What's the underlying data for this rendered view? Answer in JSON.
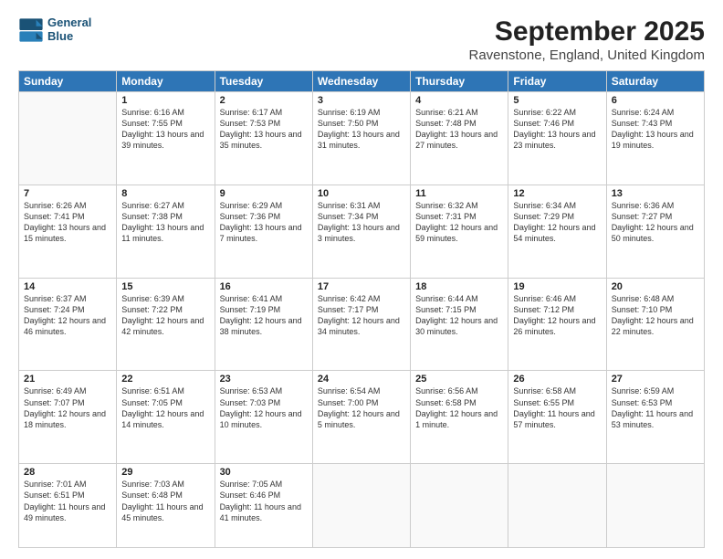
{
  "title": "September 2025",
  "subtitle": "Ravenstone, England, United Kingdom",
  "logo": {
    "line1": "General",
    "line2": "Blue"
  },
  "days": [
    "Sunday",
    "Monday",
    "Tuesday",
    "Wednesday",
    "Thursday",
    "Friday",
    "Saturday"
  ],
  "weeks": [
    [
      {
        "date": "",
        "sunrise": "",
        "sunset": "",
        "daylight": ""
      },
      {
        "date": "1",
        "sunrise": "Sunrise: 6:16 AM",
        "sunset": "Sunset: 7:55 PM",
        "daylight": "Daylight: 13 hours and 39 minutes."
      },
      {
        "date": "2",
        "sunrise": "Sunrise: 6:17 AM",
        "sunset": "Sunset: 7:53 PM",
        "daylight": "Daylight: 13 hours and 35 minutes."
      },
      {
        "date": "3",
        "sunrise": "Sunrise: 6:19 AM",
        "sunset": "Sunset: 7:50 PM",
        "daylight": "Daylight: 13 hours and 31 minutes."
      },
      {
        "date": "4",
        "sunrise": "Sunrise: 6:21 AM",
        "sunset": "Sunset: 7:48 PM",
        "daylight": "Daylight: 13 hours and 27 minutes."
      },
      {
        "date": "5",
        "sunrise": "Sunrise: 6:22 AM",
        "sunset": "Sunset: 7:46 PM",
        "daylight": "Daylight: 13 hours and 23 minutes."
      },
      {
        "date": "6",
        "sunrise": "Sunrise: 6:24 AM",
        "sunset": "Sunset: 7:43 PM",
        "daylight": "Daylight: 13 hours and 19 minutes."
      }
    ],
    [
      {
        "date": "7",
        "sunrise": "Sunrise: 6:26 AM",
        "sunset": "Sunset: 7:41 PM",
        "daylight": "Daylight: 13 hours and 15 minutes."
      },
      {
        "date": "8",
        "sunrise": "Sunrise: 6:27 AM",
        "sunset": "Sunset: 7:38 PM",
        "daylight": "Daylight: 13 hours and 11 minutes."
      },
      {
        "date": "9",
        "sunrise": "Sunrise: 6:29 AM",
        "sunset": "Sunset: 7:36 PM",
        "daylight": "Daylight: 13 hours and 7 minutes."
      },
      {
        "date": "10",
        "sunrise": "Sunrise: 6:31 AM",
        "sunset": "Sunset: 7:34 PM",
        "daylight": "Daylight: 13 hours and 3 minutes."
      },
      {
        "date": "11",
        "sunrise": "Sunrise: 6:32 AM",
        "sunset": "Sunset: 7:31 PM",
        "daylight": "Daylight: 12 hours and 59 minutes."
      },
      {
        "date": "12",
        "sunrise": "Sunrise: 6:34 AM",
        "sunset": "Sunset: 7:29 PM",
        "daylight": "Daylight: 12 hours and 54 minutes."
      },
      {
        "date": "13",
        "sunrise": "Sunrise: 6:36 AM",
        "sunset": "Sunset: 7:27 PM",
        "daylight": "Daylight: 12 hours and 50 minutes."
      }
    ],
    [
      {
        "date": "14",
        "sunrise": "Sunrise: 6:37 AM",
        "sunset": "Sunset: 7:24 PM",
        "daylight": "Daylight: 12 hours and 46 minutes."
      },
      {
        "date": "15",
        "sunrise": "Sunrise: 6:39 AM",
        "sunset": "Sunset: 7:22 PM",
        "daylight": "Daylight: 12 hours and 42 minutes."
      },
      {
        "date": "16",
        "sunrise": "Sunrise: 6:41 AM",
        "sunset": "Sunset: 7:19 PM",
        "daylight": "Daylight: 12 hours and 38 minutes."
      },
      {
        "date": "17",
        "sunrise": "Sunrise: 6:42 AM",
        "sunset": "Sunset: 7:17 PM",
        "daylight": "Daylight: 12 hours and 34 minutes."
      },
      {
        "date": "18",
        "sunrise": "Sunrise: 6:44 AM",
        "sunset": "Sunset: 7:15 PM",
        "daylight": "Daylight: 12 hours and 30 minutes."
      },
      {
        "date": "19",
        "sunrise": "Sunrise: 6:46 AM",
        "sunset": "Sunset: 7:12 PM",
        "daylight": "Daylight: 12 hours and 26 minutes."
      },
      {
        "date": "20",
        "sunrise": "Sunrise: 6:48 AM",
        "sunset": "Sunset: 7:10 PM",
        "daylight": "Daylight: 12 hours and 22 minutes."
      }
    ],
    [
      {
        "date": "21",
        "sunrise": "Sunrise: 6:49 AM",
        "sunset": "Sunset: 7:07 PM",
        "daylight": "Daylight: 12 hours and 18 minutes."
      },
      {
        "date": "22",
        "sunrise": "Sunrise: 6:51 AM",
        "sunset": "Sunset: 7:05 PM",
        "daylight": "Daylight: 12 hours and 14 minutes."
      },
      {
        "date": "23",
        "sunrise": "Sunrise: 6:53 AM",
        "sunset": "Sunset: 7:03 PM",
        "daylight": "Daylight: 12 hours and 10 minutes."
      },
      {
        "date": "24",
        "sunrise": "Sunrise: 6:54 AM",
        "sunset": "Sunset: 7:00 PM",
        "daylight": "Daylight: 12 hours and 5 minutes."
      },
      {
        "date": "25",
        "sunrise": "Sunrise: 6:56 AM",
        "sunset": "Sunset: 6:58 PM",
        "daylight": "Daylight: 12 hours and 1 minute."
      },
      {
        "date": "26",
        "sunrise": "Sunrise: 6:58 AM",
        "sunset": "Sunset: 6:55 PM",
        "daylight": "Daylight: 11 hours and 57 minutes."
      },
      {
        "date": "27",
        "sunrise": "Sunrise: 6:59 AM",
        "sunset": "Sunset: 6:53 PM",
        "daylight": "Daylight: 11 hours and 53 minutes."
      }
    ],
    [
      {
        "date": "28",
        "sunrise": "Sunrise: 7:01 AM",
        "sunset": "Sunset: 6:51 PM",
        "daylight": "Daylight: 11 hours and 49 minutes."
      },
      {
        "date": "29",
        "sunrise": "Sunrise: 7:03 AM",
        "sunset": "Sunset: 6:48 PM",
        "daylight": "Daylight: 11 hours and 45 minutes."
      },
      {
        "date": "30",
        "sunrise": "Sunrise: 7:05 AM",
        "sunset": "Sunset: 6:46 PM",
        "daylight": "Daylight: 11 hours and 41 minutes."
      },
      {
        "date": "",
        "sunrise": "",
        "sunset": "",
        "daylight": ""
      },
      {
        "date": "",
        "sunrise": "",
        "sunset": "",
        "daylight": ""
      },
      {
        "date": "",
        "sunrise": "",
        "sunset": "",
        "daylight": ""
      },
      {
        "date": "",
        "sunrise": "",
        "sunset": "",
        "daylight": ""
      }
    ]
  ]
}
